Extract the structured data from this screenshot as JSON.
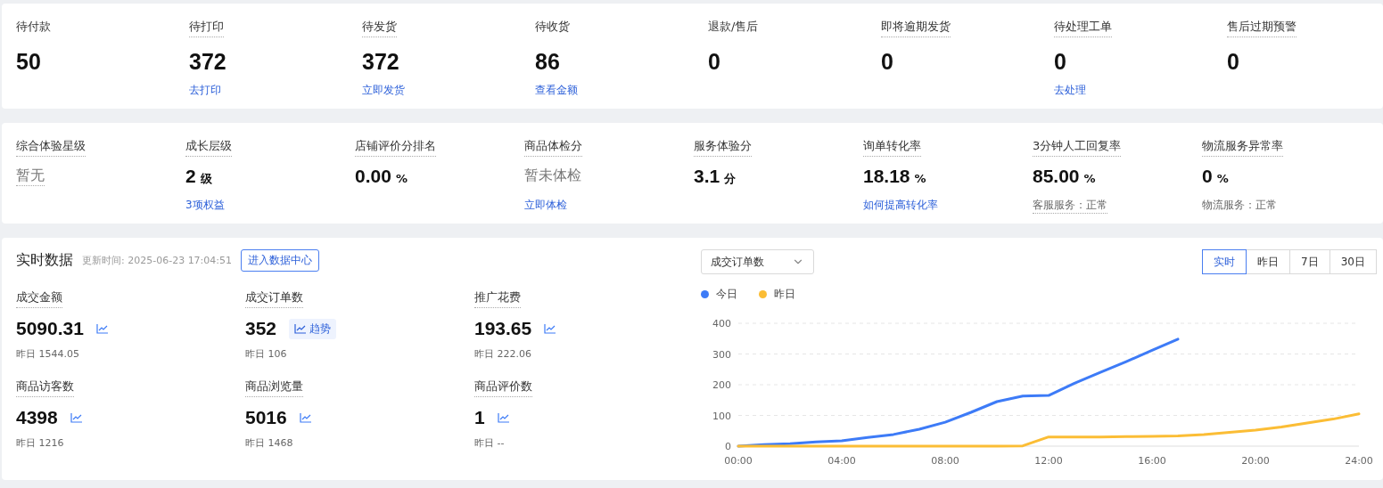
{
  "orders": [
    {
      "label": "待付款",
      "dotted": false,
      "value": "50"
    },
    {
      "label": "待打印",
      "dotted": true,
      "value": "372",
      "link": "去打印"
    },
    {
      "label": "待发货",
      "dotted": true,
      "value": "372",
      "link": "立即发货"
    },
    {
      "label": "待收货",
      "dotted": false,
      "value": "86",
      "link": "查看金额"
    },
    {
      "label": "退款/售后",
      "dotted": false,
      "value": "0"
    },
    {
      "label": "即将逾期发货",
      "dotted": true,
      "value": "0"
    },
    {
      "label": "待处理工单",
      "dotted": true,
      "value": "0",
      "link": "去处理"
    },
    {
      "label": "售后过期预警",
      "dotted": true,
      "value": "0"
    }
  ],
  "experience": [
    {
      "label": "综合体验星级",
      "kind": "text",
      "value": "暂无",
      "dotted": true
    },
    {
      "label": "成长层级",
      "kind": "number",
      "value": "2",
      "unit": "级",
      "sub": {
        "kind": "link",
        "text": "3项权益",
        "dotted": false
      }
    },
    {
      "label": "店铺评价分排名",
      "kind": "number",
      "value": "0.00",
      "unit": "%"
    },
    {
      "label": "商品体检分",
      "kind": "text",
      "value": "暂未体检",
      "dotted": false,
      "sub": {
        "kind": "link",
        "text": "立即体检",
        "dotted": false
      }
    },
    {
      "label": "服务体验分",
      "kind": "number",
      "value": "3.1",
      "unit": "分"
    },
    {
      "label": "询单转化率",
      "kind": "number",
      "value": "18.18",
      "unit": "%",
      "sub": {
        "kind": "link",
        "text": "如何提高转化率",
        "dotted": false
      }
    },
    {
      "label": "3分钟人工回复率",
      "kind": "number",
      "value": "85.00",
      "unit": "%",
      "sub": {
        "kind": "note",
        "text": "客服服务：正常",
        "dotted": true
      }
    },
    {
      "label": "物流服务异常率",
      "kind": "number",
      "value": "0",
      "unit": "%",
      "sub": {
        "kind": "note",
        "text": "物流服务：正常",
        "dotted": false
      }
    }
  ],
  "realtime": {
    "title": "实时数据",
    "updated": "更新时间: 2025-06-23 17:04:51",
    "button": "进入数据中心",
    "metrics": [
      {
        "label": "成交金额",
        "value": "5090.31",
        "kind": "icon",
        "yesterday": "昨日 1544.05"
      },
      {
        "label": "成交订单数",
        "value": "352",
        "kind": "button",
        "trend": "趋势",
        "yesterday": "昨日 106"
      },
      {
        "label": "推广花费",
        "value": "193.65",
        "kind": "icon",
        "yesterday": "昨日 222.06"
      },
      {
        "label": "商品访客数",
        "value": "4398",
        "kind": "icon",
        "yesterday": "昨日 1216"
      },
      {
        "label": "商品浏览量",
        "value": "5016",
        "kind": "icon",
        "yesterday": "昨日 1468"
      },
      {
        "label": "商品评价数",
        "value": "1",
        "kind": "icon",
        "yesterday": "昨日 --"
      }
    ]
  },
  "chart_panel": {
    "select": "成交订单数",
    "ranges": [
      {
        "label": "实时",
        "selected": true
      },
      {
        "label": "昨日",
        "selected": false
      },
      {
        "label": "7日",
        "selected": false
      },
      {
        "label": "30日",
        "selected": false
      }
    ],
    "chart_data": {
      "type": "line",
      "x": [
        0,
        1,
        2,
        3,
        4,
        5,
        6,
        7,
        8,
        9,
        10,
        11,
        12,
        13,
        14,
        15,
        16,
        17,
        18,
        19,
        20,
        21,
        22,
        23,
        24
      ],
      "series": [
        {
          "name": "今日",
          "color": "#3d7bf7",
          "values": [
            0,
            5,
            8,
            14,
            17,
            28,
            38,
            55,
            78,
            110,
            145,
            163,
            165,
            205,
            240,
            275,
            312,
            348,
            null,
            null,
            null,
            null,
            null,
            null,
            null
          ]
        },
        {
          "name": "昨日",
          "color": "#fbbd35",
          "values": [
            0,
            0,
            0,
            0,
            0,
            0,
            0,
            0,
            0,
            0,
            0,
            1,
            30,
            30,
            30,
            31,
            32,
            33,
            38,
            45,
            52,
            62,
            75,
            88,
            105
          ]
        }
      ],
      "grid": true,
      "xlim": [
        0,
        24
      ],
      "ylim": [
        0,
        400
      ],
      "xticks": [
        {
          "value": 0,
          "label": "00:00"
        },
        {
          "value": 4,
          "label": "04:00"
        },
        {
          "value": 8,
          "label": "08:00"
        },
        {
          "value": 12,
          "label": "12:00"
        },
        {
          "value": 16,
          "label": "16:00"
        },
        {
          "value": 20,
          "label": "20:00"
        },
        {
          "value": 24,
          "label": "24:00"
        }
      ],
      "yticks": [
        0,
        100,
        200,
        300,
        400
      ]
    }
  }
}
